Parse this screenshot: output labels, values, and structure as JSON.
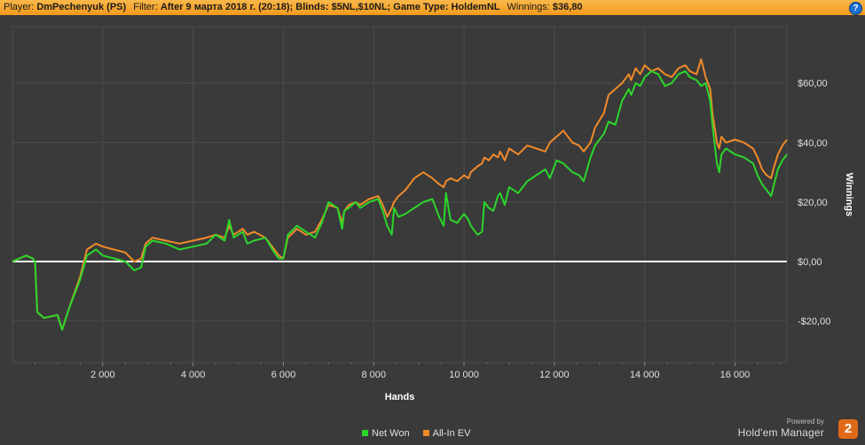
{
  "header": {
    "player_label": "Player:",
    "player_value": "DmPechenyuk (PS)",
    "filter_label": "Filter:",
    "filter_value": "After 9 марта 2018 г. (20:18); Blinds: $5NL,$10NL; Game Type: HoldemNL",
    "winnings_label": "Winnings:",
    "winnings_value": "$36,80",
    "help_glyph": "?"
  },
  "brand": {
    "powered_by": "Powered by",
    "name": "Hold'em Manager",
    "logo_text": "2"
  },
  "colors": {
    "background": "#3a3a3a",
    "grid": "#4c4c4c",
    "zero_line": "#ffffff",
    "net_won": "#2bd62b",
    "all_in_ev": "#f08a2a",
    "header": "#f5a623"
  },
  "chart_data": {
    "type": "line",
    "xlabel": "Hands",
    "ylabel": "Winnings",
    "xlim": [
      0,
      17150
    ],
    "ylim": [
      -34,
      79
    ],
    "x_ticks": [
      2000,
      4000,
      6000,
      8000,
      10000,
      12000,
      14000,
      16000
    ],
    "x_tick_labels": [
      "2 000",
      "4 000",
      "6 000",
      "8 000",
      "10 000",
      "12 000",
      "14 000",
      "16 000"
    ],
    "y_ticks": [
      -20,
      0,
      20,
      40,
      60
    ],
    "y_tick_labels": [
      "-$20,00",
      "$0,00",
      "$20,00",
      "$40,00",
      "$60,00"
    ],
    "grid": true,
    "legend_position": "bottom-center",
    "series": [
      {
        "name": "Net Won",
        "color": "#2bd62b",
        "x": [
          0,
          300,
          450,
          500,
          550,
          700,
          1000,
          1100,
          1250,
          1500,
          1650,
          1850,
          2000,
          2250,
          2500,
          2700,
          2850,
          2950,
          3100,
          3400,
          3700,
          4000,
          4300,
          4500,
          4700,
          4800,
          4900,
          5100,
          5200,
          5350,
          5600,
          5800,
          5900,
          6000,
          6100,
          6300,
          6500,
          6700,
          6850,
          7000,
          7200,
          7300,
          7350,
          7450,
          7600,
          7700,
          7900,
          8100,
          8200,
          8300,
          8400,
          8450,
          8550,
          8700,
          8900,
          9100,
          9300,
          9450,
          9550,
          9600,
          9700,
          9850,
          10000,
          10100,
          10150,
          10300,
          10400,
          10450,
          10550,
          10650,
          10750,
          10800,
          10900,
          11000,
          11200,
          11400,
          11600,
          11800,
          11900,
          12050,
          12200,
          12400,
          12550,
          12650,
          12800,
          12900,
          13100,
          13200,
          13350,
          13500,
          13650,
          13700,
          13800,
          13900,
          14000,
          14150,
          14300,
          14450,
          14600,
          14750,
          14900,
          15000,
          15150,
          15250,
          15350,
          15450,
          15500,
          15600,
          15650,
          15700,
          15800,
          16000,
          16200,
          16400,
          16500,
          16600,
          16700,
          16800,
          16850,
          16950,
          17050,
          17150
        ],
        "values": [
          0,
          2,
          1,
          0,
          -17,
          -19,
          -18,
          -23,
          -16,
          -6,
          2,
          4,
          2,
          1,
          0,
          -3,
          -2,
          5,
          7,
          6,
          4,
          5,
          6,
          9,
          7,
          14,
          8,
          10,
          6,
          7,
          8,
          3,
          1,
          1,
          9,
          12,
          10,
          8,
          13,
          20,
          18,
          11,
          17,
          18,
          20,
          18,
          20,
          21,
          17,
          12,
          9,
          18,
          15,
          16,
          18,
          20,
          21,
          15,
          12,
          23,
          14,
          13,
          16,
          14,
          12,
          9,
          10,
          20,
          18,
          17,
          22,
          23,
          19,
          25,
          23,
          27,
          29,
          31,
          28,
          34,
          33,
          30,
          29,
          27,
          35,
          39,
          43,
          47,
          46,
          54,
          58,
          56,
          60,
          59,
          62,
          64,
          63,
          59,
          60,
          63,
          64,
          62,
          61,
          59,
          60,
          54,
          46,
          33,
          30,
          36,
          38,
          36,
          35,
          33,
          29,
          26,
          24,
          22,
          25,
          31,
          34,
          36
        ]
      },
      {
        "name": "All-In EV",
        "color": "#f08a2a",
        "x": [
          0,
          300,
          450,
          500,
          550,
          700,
          1000,
          1100,
          1250,
          1500,
          1650,
          1850,
          2000,
          2250,
          2500,
          2700,
          2850,
          2950,
          3100,
          3400,
          3700,
          4000,
          4300,
          4500,
          4700,
          4800,
          4900,
          5100,
          5200,
          5350,
          5600,
          5800,
          5900,
          6000,
          6100,
          6300,
          6500,
          6700,
          6850,
          7000,
          7200,
          7300,
          7350,
          7450,
          7600,
          7700,
          7900,
          8100,
          8200,
          8300,
          8400,
          8450,
          8550,
          8700,
          8900,
          9100,
          9300,
          9450,
          9550,
          9600,
          9700,
          9850,
          10000,
          10100,
          10150,
          10300,
          10400,
          10450,
          10550,
          10650,
          10750,
          10800,
          10900,
          11000,
          11200,
          11400,
          11600,
          11800,
          11900,
          12050,
          12200,
          12400,
          12550,
          12650,
          12800,
          12900,
          13100,
          13200,
          13350,
          13500,
          13650,
          13700,
          13800,
          13900,
          14000,
          14150,
          14300,
          14450,
          14600,
          14750,
          14900,
          15000,
          15150,
          15250,
          15350,
          15450,
          15500,
          15600,
          15650,
          15700,
          15800,
          16000,
          16200,
          16400,
          16500,
          16600,
          16700,
          16800,
          16850,
          16950,
          17050,
          17150
        ],
        "values": [
          0,
          2,
          1,
          0,
          -17,
          -19,
          -18,
          -23,
          -16,
          -5,
          4,
          6,
          5,
          4,
          3,
          0,
          1,
          6,
          8,
          7,
          6,
          7,
          8,
          9,
          8,
          12,
          9,
          11,
          9,
          10,
          8,
          4,
          2,
          1,
          8,
          11,
          9,
          10,
          14,
          19,
          18,
          13,
          17,
          19,
          20,
          19,
          21,
          22,
          19,
          15,
          18,
          20,
          22,
          24,
          28,
          30,
          28,
          26,
          25,
          27,
          28,
          27,
          29,
          28,
          30,
          32,
          33,
          35,
          34,
          36,
          35,
          37,
          34,
          38,
          36,
          39,
          38,
          37,
          40,
          42,
          44,
          40,
          39,
          37,
          40,
          45,
          50,
          56,
          58,
          60,
          63,
          61,
          65,
          63,
          66,
          64,
          65,
          63,
          62,
          65,
          66,
          64,
          63,
          68,
          62,
          58,
          50,
          40,
          38,
          42,
          40,
          41,
          40,
          38,
          35,
          31,
          29,
          28,
          31,
          36,
          39,
          41
        ]
      }
    ]
  }
}
